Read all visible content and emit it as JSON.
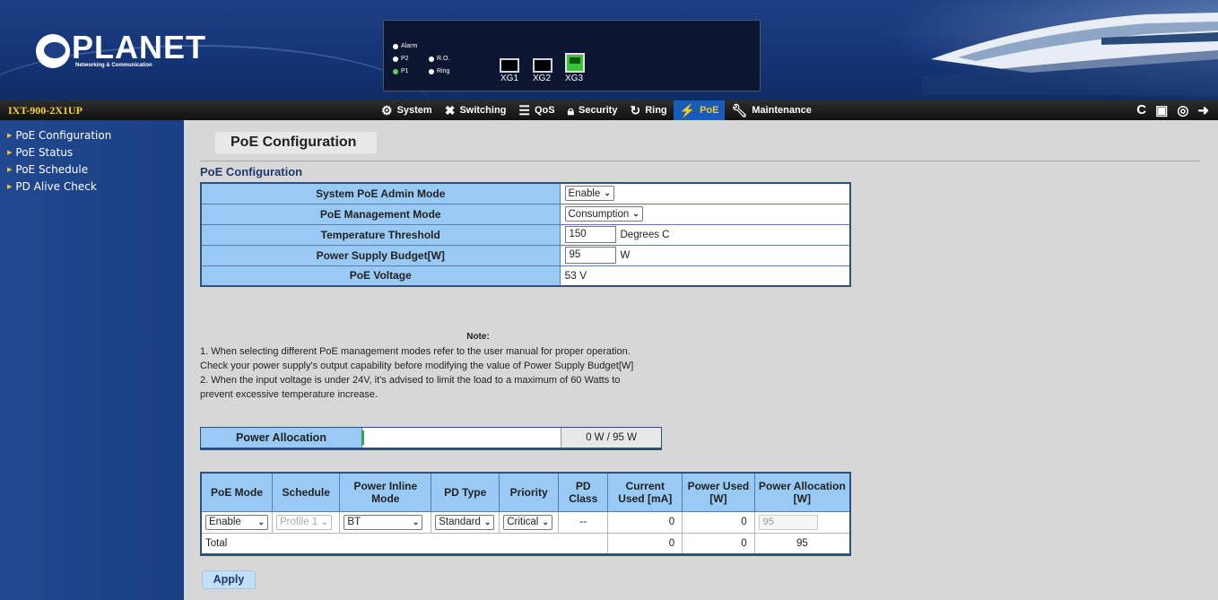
{
  "banner": {
    "brand": "PLANET",
    "tagline": "Networking & Communication",
    "leds": {
      "alarm": "Alarm",
      "p2": "P2",
      "ro": "R.O.",
      "p1": "P1",
      "ring": "Ring"
    },
    "ports": [
      "XG1",
      "XG2",
      "XG3"
    ]
  },
  "navbar": {
    "model": "IXT-900-2X1UP",
    "menu": [
      {
        "label": "System",
        "icon": "gear-icon"
      },
      {
        "label": "Switching",
        "icon": "switching-icon"
      },
      {
        "label": "QoS",
        "icon": "qos-icon"
      },
      {
        "label": "Security",
        "icon": "lock-icon"
      },
      {
        "label": "Ring",
        "icon": "ring-icon"
      },
      {
        "label": "PoE",
        "icon": "poe-icon"
      },
      {
        "label": "Maintenance",
        "icon": "wrench-icon"
      }
    ],
    "active_menu": "PoE",
    "tools": [
      "refresh-icon",
      "save-icon",
      "help-icon",
      "logout-icon"
    ]
  },
  "sidebar": {
    "items": [
      {
        "label": "PoE Configuration"
      },
      {
        "label": "PoE Status"
      },
      {
        "label": "PoE Schedule"
      },
      {
        "label": "PD Alive Check"
      }
    ]
  },
  "main": {
    "page_title": "PoE Configuration",
    "section_title": "PoE Configuration",
    "config": {
      "admin_mode_label": "System PoE Admin Mode",
      "admin_mode_value": "Enable",
      "mgmt_mode_label": "PoE Management Mode",
      "mgmt_mode_value": "Consumption",
      "temp_label": "Temperature Threshold",
      "temp_value": "150",
      "temp_unit": "Degrees C",
      "budget_label": "Power Supply Budget[W]",
      "budget_value": "95",
      "budget_unit": "W",
      "voltage_label": "PoE Voltage",
      "voltage_value": "53 V"
    },
    "note": {
      "title": "Note:",
      "lines": [
        "1. When selecting different PoE management modes refer to the user manual for proper operation.",
        "Check your power supply's output capability before modifying the value of Power Supply Budget[W]",
        "2. When the input voltage is under 24V, it's advised to limit the load to a maximum of 60 Watts to",
        "prevent excessive temperature increase."
      ]
    },
    "allocation": {
      "label": "Power Allocation",
      "value": "0 W / 95 W",
      "fraction": 0
    },
    "ports_table": {
      "headers": [
        "PoE Mode",
        "Schedule",
        "Power Inline Mode",
        "PD Type",
        "Priority",
        "PD Class",
        "Current Used [mA]",
        "Power Used [W]",
        "Power Allocation [W]"
      ],
      "row": {
        "poe_mode": "Enable",
        "schedule": "Profile 1",
        "inline_mode": "BT",
        "pd_type": "Standard",
        "priority": "Critical",
        "pd_class": "--",
        "current": "0",
        "power_used": "0",
        "allocation": "95"
      },
      "total": {
        "label": "Total",
        "current": "0",
        "power_used": "0",
        "allocation": "95"
      }
    },
    "apply_label": "Apply"
  }
}
